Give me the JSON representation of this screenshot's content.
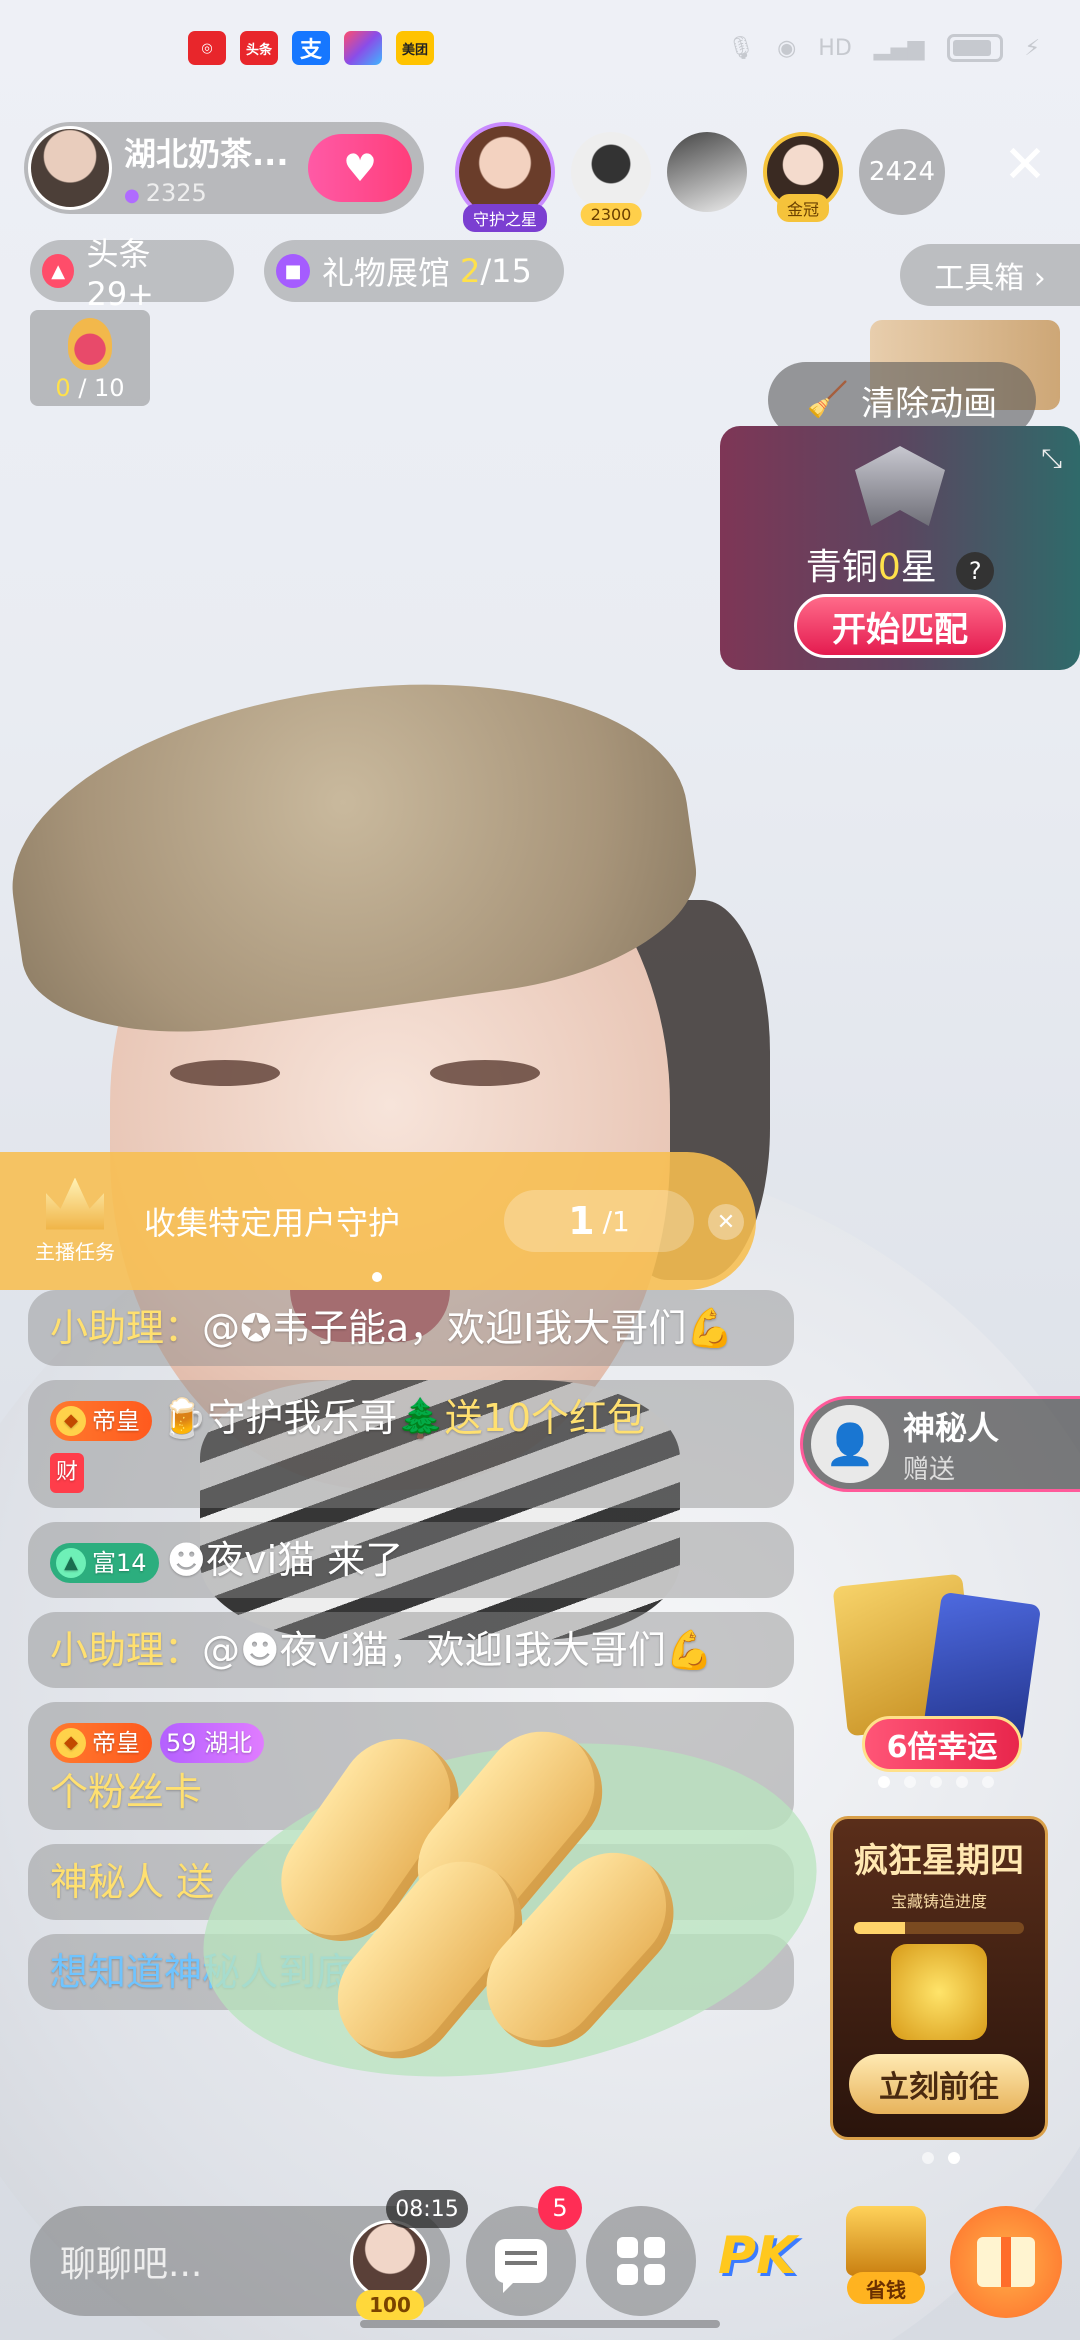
{
  "status_bar": {
    "apps": [
      {
        "name": "red-app-icon",
        "label": "",
        "color": "#e8262b"
      },
      {
        "name": "toutiao-icon",
        "label": "头条",
        "color": "#e8262b"
      },
      {
        "name": "alipay-icon",
        "label": "支",
        "color": "#1677ff"
      },
      {
        "name": "colorful-app-icon",
        "label": "",
        "color": "#8a4de8"
      },
      {
        "name": "meituan-icon",
        "label": "美团",
        "color": "#ffc300"
      }
    ]
  },
  "host": {
    "name": "湖北奶茶...",
    "score": "2325",
    "follow_symbol": "+"
  },
  "ranking": {
    "guard_star_label": "守护之星",
    "second_viewer_score": "2300",
    "fifth_viewer_tag": "金冠",
    "viewer_count": "2424"
  },
  "pills": {
    "headline": "头条29+",
    "gift_hall_prefix": "礼物展馆",
    "gift_hall_current": "2",
    "gift_hall_total": "/15",
    "toolbox": "工具箱 ›"
  },
  "gift_progress": {
    "current": "0",
    "total": " / 10"
  },
  "clear_animation": "清除动画",
  "rank_card": {
    "tier_prefix": "青铜",
    "tier_level": "0",
    "tier_suffix": "星",
    "help": "?",
    "match_button": "开始匹配"
  },
  "task": {
    "icon_label": "主播任务",
    "text": "收集特定用户守护",
    "progress_current": "1",
    "progress_total": "/1"
  },
  "chat": {
    "msg1": {
      "helper": "小助理：",
      "body": "@✪韦子能a，欢迎I我大哥们💪"
    },
    "msg2": {
      "badge": "帝皇",
      "user": "🍺守护我乐哥🌲",
      "action": "送10个红包",
      "tag": "财"
    },
    "msg3": {
      "badge": "富14",
      "user": "☻夜vi猫",
      "action": " 来了"
    },
    "msg4": {
      "helper": "小助理：",
      "body": "@☻夜vi猫，欢迎I我大哥们💪"
    },
    "msg5": {
      "badge": "帝皇",
      "fan_level": "59",
      "fan_name": "湖北",
      "body": "个粉丝卡"
    },
    "msg6": {
      "user": "神秘人",
      "body": "送"
    },
    "msg7": {
      "body": "想知道神秘人到底是"
    }
  },
  "mystery_gift": {
    "name": "神秘人",
    "action": "赠送"
  },
  "luck_widget": {
    "label": "6倍幸运"
  },
  "thursday_event": {
    "title": "疯狂星期四",
    "subtitle": "宝藏铸造进度",
    "progress": 0.3,
    "button": "立刻前往"
  },
  "bottom_bar": {
    "input_placeholder": "聊聊吧...",
    "timer": "08:15",
    "avatar_level": "100",
    "message_badge": "5",
    "pk_label": "PK",
    "save_label": "省钱"
  }
}
